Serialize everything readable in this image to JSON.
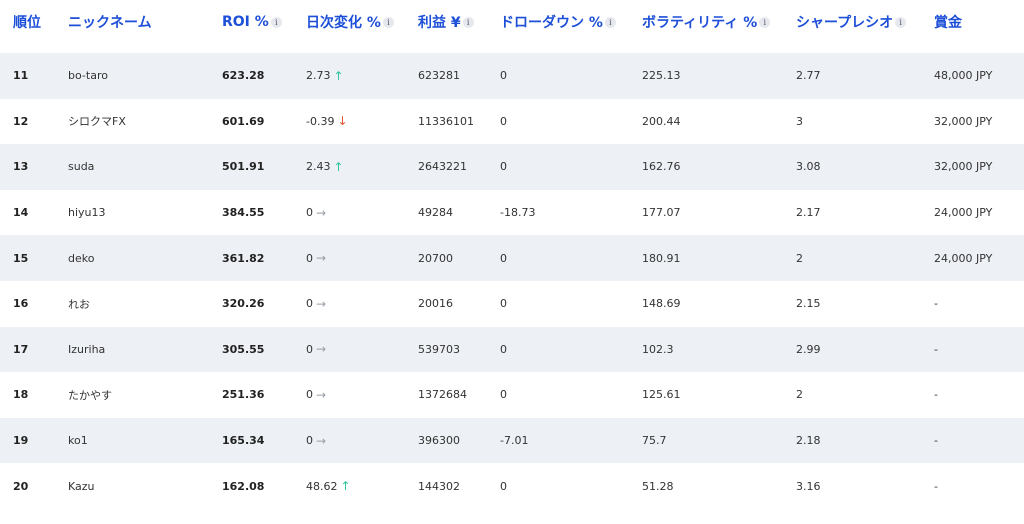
{
  "header": {
    "rank": "順位",
    "nickname": "ニックネーム",
    "roi": "ROI %",
    "daily_change": "日次変化 %",
    "profit": "利益 ¥",
    "drawdown": "ドローダウン %",
    "volatility": "ボラティリティ %",
    "sharpe": "シャープレシオ",
    "prize": "賞金",
    "info_glyph": "i"
  },
  "arrows": {
    "up": "↑",
    "down": "↓",
    "flat": "→"
  },
  "rows": [
    {
      "rank": "11",
      "nickname": "bo-taro",
      "roi": "623.28",
      "daily": "2.73",
      "trend": "up",
      "profit": "623281",
      "drawdown": "0",
      "volatility": "225.13",
      "sharpe": "2.77",
      "prize": "48,000 JPY"
    },
    {
      "rank": "12",
      "nickname": "シロクマFX",
      "roi": "601.69",
      "daily": "-0.39",
      "trend": "down",
      "profit": "11336101",
      "drawdown": "0",
      "volatility": "200.44",
      "sharpe": "3",
      "prize": "32,000 JPY"
    },
    {
      "rank": "13",
      "nickname": "suda",
      "roi": "501.91",
      "daily": "2.43",
      "trend": "up",
      "profit": "2643221",
      "drawdown": "0",
      "volatility": "162.76",
      "sharpe": "3.08",
      "prize": "32,000 JPY"
    },
    {
      "rank": "14",
      "nickname": "hiyu13",
      "roi": "384.55",
      "daily": "0",
      "trend": "flat",
      "profit": "49284",
      "drawdown": "-18.73",
      "volatility": "177.07",
      "sharpe": "2.17",
      "prize": "24,000 JPY"
    },
    {
      "rank": "15",
      "nickname": "deko",
      "roi": "361.82",
      "daily": "0",
      "trend": "flat",
      "profit": "20700",
      "drawdown": "0",
      "volatility": "180.91",
      "sharpe": "2",
      "prize": "24,000 JPY"
    },
    {
      "rank": "16",
      "nickname": "れお",
      "roi": "320.26",
      "daily": "0",
      "trend": "flat",
      "profit": "20016",
      "drawdown": "0",
      "volatility": "148.69",
      "sharpe": "2.15",
      "prize": "-"
    },
    {
      "rank": "17",
      "nickname": "Izuriha",
      "roi": "305.55",
      "daily": "0",
      "trend": "flat",
      "profit": "539703",
      "drawdown": "0",
      "volatility": "102.3",
      "sharpe": "2.99",
      "prize": "-"
    },
    {
      "rank": "18",
      "nickname": "たかやす",
      "roi": "251.36",
      "daily": "0",
      "trend": "flat",
      "profit": "1372684",
      "drawdown": "0",
      "volatility": "125.61",
      "sharpe": "2",
      "prize": "-"
    },
    {
      "rank": "19",
      "nickname": "ko1",
      "roi": "165.34",
      "daily": "0",
      "trend": "flat",
      "profit": "396300",
      "drawdown": "-7.01",
      "volatility": "75.7",
      "sharpe": "2.18",
      "prize": "-"
    },
    {
      "rank": "20",
      "nickname": "Kazu",
      "roi": "162.08",
      "daily": "48.62",
      "trend": "up",
      "profit": "144302",
      "drawdown": "0",
      "volatility": "51.28",
      "sharpe": "3.16",
      "prize": "-"
    }
  ]
}
